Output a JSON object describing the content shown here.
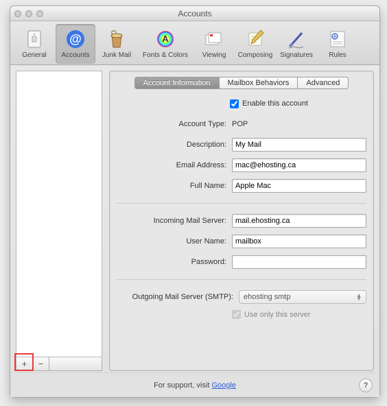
{
  "window": {
    "title": "Accounts"
  },
  "toolbar": {
    "items": [
      {
        "label": "General",
        "icon": "switch-icon"
      },
      {
        "label": "Accounts",
        "icon": "at-icon"
      },
      {
        "label": "Junk Mail",
        "icon": "trash-icon"
      },
      {
        "label": "Fonts & Colors",
        "icon": "palette-icon"
      },
      {
        "label": "Viewing",
        "icon": "cards-icon"
      },
      {
        "label": "Composing",
        "icon": "compose-icon"
      },
      {
        "label": "Signatures",
        "icon": "pen-icon"
      },
      {
        "label": "Rules",
        "icon": "rules-icon"
      }
    ],
    "selected_index": 1
  },
  "tabs": {
    "items": [
      "Account Information",
      "Mailbox Behaviors",
      "Advanced"
    ],
    "active_index": 0
  },
  "form": {
    "enable_label": "Enable this account",
    "enable_checked": true,
    "account_type_label": "Account Type:",
    "account_type_value": "POP",
    "description_label": "Description:",
    "description_value": "My Mail",
    "email_label": "Email Address:",
    "email_value": "mac@ehosting.ca",
    "fullname_label": "Full Name:",
    "fullname_value": "Apple Mac",
    "incoming_label": "Incoming Mail Server:",
    "incoming_value": "mail.ehosting.ca",
    "username_label": "User Name:",
    "username_value": "mailbox",
    "password_label": "Password:",
    "password_value": "",
    "smtp_label": "Outgoing Mail Server (SMTP):",
    "smtp_value": "ehosting smtp",
    "use_only_label": "Use only this server",
    "use_only_checked": true
  },
  "sidebar_buttons": {
    "add": "+",
    "remove": "−"
  },
  "footer": {
    "prefix": "For support, visit ",
    "link_text": "Google"
  },
  "help": "?"
}
